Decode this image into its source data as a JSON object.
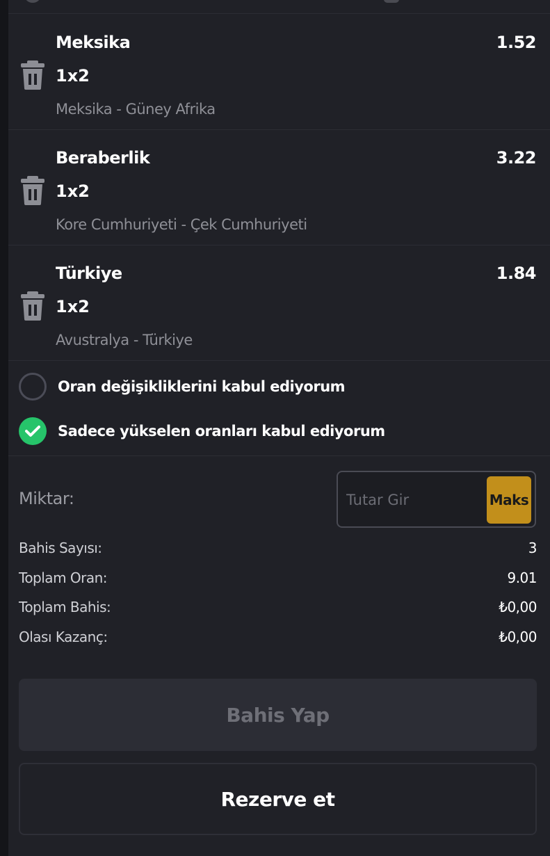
{
  "bets": [
    {
      "selection": "Meksika",
      "odd": "1.52",
      "market": "1x2",
      "match": "Meksika - Güney Afrika"
    },
    {
      "selection": "Beraberlik",
      "odd": "3.22",
      "market": "1x2",
      "match": "Kore Cumhuriyeti - Çek Cumhuriyeti"
    },
    {
      "selection": "Türkiye",
      "odd": "1.84",
      "market": "1x2",
      "match": "Avustralya - Türkiye"
    }
  ],
  "options": [
    {
      "label": "Oran değişikliklerini kabul ediyorum",
      "checked": false
    },
    {
      "label": "Sadece yükselen oranları kabul ediyorum",
      "checked": true
    }
  ],
  "stake": {
    "label": "Miktar:",
    "placeholder": "Tutar Gir",
    "value": "",
    "max_label": "Maks"
  },
  "summary": [
    {
      "label": "Bahis Sayısı:",
      "value": "3"
    },
    {
      "label": "Toplam Oran:",
      "value": "9.01"
    },
    {
      "label": "Toplam Bahis:",
      "value": "₺0,00"
    },
    {
      "label": "Olası Kazanç:",
      "value": "₺0,00"
    }
  ],
  "actions": {
    "place_bet": "Bahis Yap",
    "reserve": "Rezerve et"
  },
  "colors": {
    "panel": "#202127",
    "check_green": "#26c46a",
    "max_button": "#c28f1b",
    "muted_text": "#8f9097"
  },
  "icons": {
    "remove": "trash-icon",
    "checked": "checkmark-icon"
  }
}
